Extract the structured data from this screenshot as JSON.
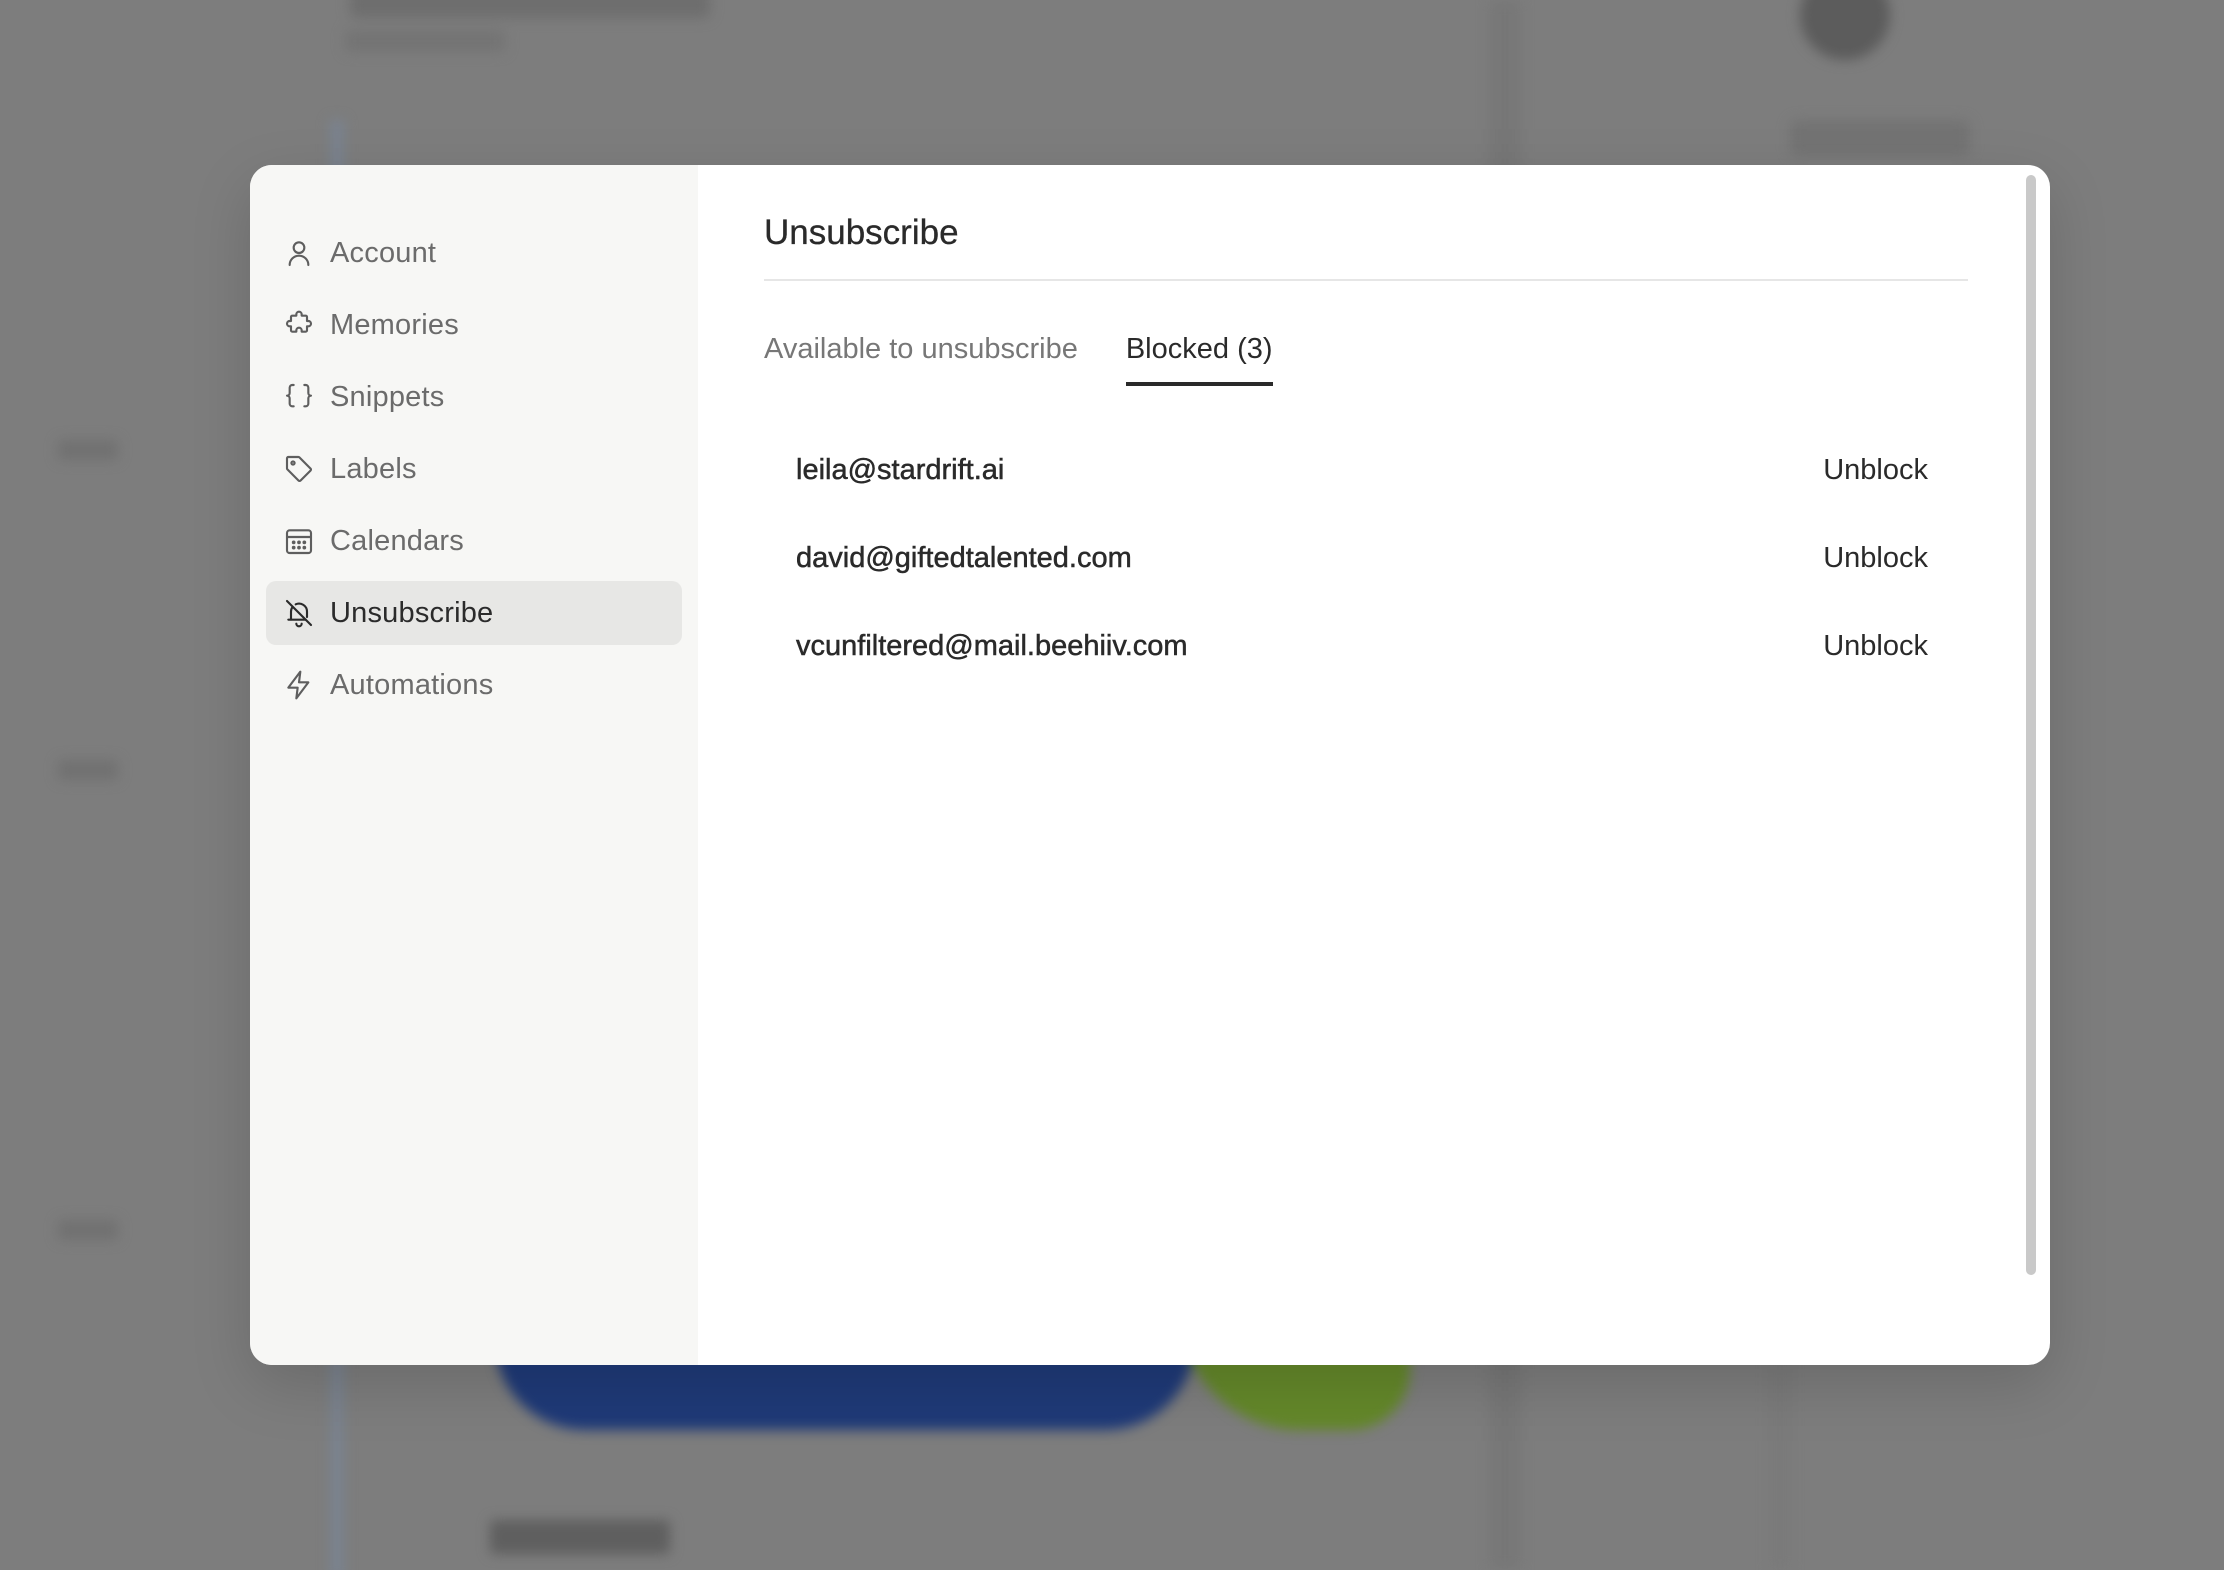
{
  "sidebar": {
    "items": [
      {
        "label": "Account",
        "icon": "user-icon"
      },
      {
        "label": "Memories",
        "icon": "puzzle-icon"
      },
      {
        "label": "Snippets",
        "icon": "braces-icon"
      },
      {
        "label": "Labels",
        "icon": "tag-icon"
      },
      {
        "label": "Calendars",
        "icon": "calendar-icon"
      },
      {
        "label": "Unsubscribe",
        "icon": "bell-off-icon",
        "active": true
      },
      {
        "label": "Automations",
        "icon": "bolt-icon"
      }
    ]
  },
  "main": {
    "title": "Unsubscribe",
    "tabs": [
      {
        "label": "Available to unsubscribe"
      },
      {
        "label": "Blocked (3)",
        "active": true
      }
    ],
    "blocked": [
      {
        "email": "leila@stardrift.ai",
        "action": "Unblock"
      },
      {
        "email": "david@giftedtalented.com",
        "action": "Unblock"
      },
      {
        "email": "vcunfiltered@mail.beehiiv.com",
        "action": "Unblock"
      }
    ]
  },
  "colors": {
    "overlay": "#7d7d7d",
    "sidebar_bg": "#f7f7f5",
    "active_item_bg": "#e7e7e5",
    "text_primary": "#2a2a2a",
    "text_muted": "#6b6b6b"
  }
}
